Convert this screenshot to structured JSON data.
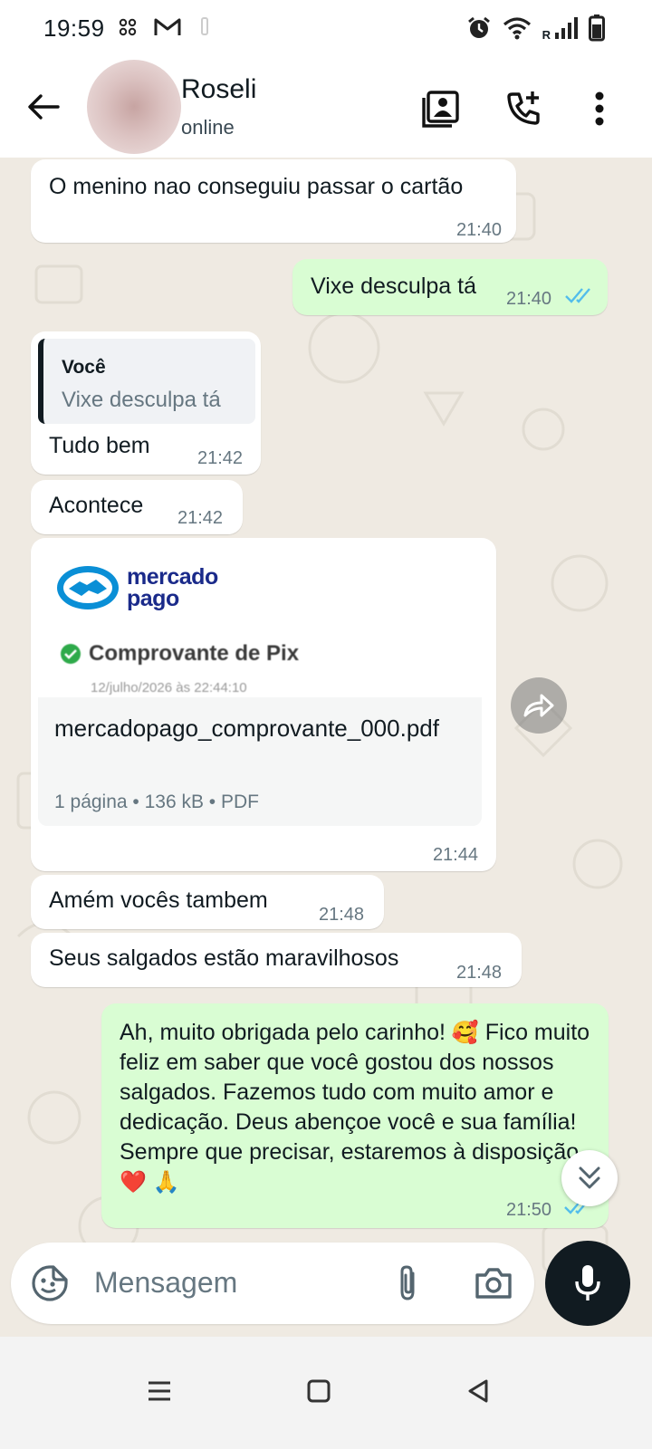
{
  "status_bar": {
    "time": "19:59",
    "network_label": "R",
    "icons": [
      "link-icon",
      "gmail-icon",
      "notification-icon",
      "alarm-icon",
      "wifi-icon",
      "signal-icon",
      "battery-icon"
    ]
  },
  "header": {
    "contact_name": "Roseli",
    "contact_status": "online",
    "icons": [
      "back-arrow-icon",
      "contact-card-icon",
      "add-call-icon",
      "more-vert-icon"
    ]
  },
  "messages": [
    {
      "direction": "in",
      "text": "O menino nao conseguiu passar o cartão",
      "time": "21:40"
    },
    {
      "direction": "out",
      "text": "Vixe desculpa tá",
      "time": "21:40",
      "status": "read"
    },
    {
      "direction": "in",
      "quote": {
        "author": "Você",
        "text": "Vixe desculpa tá"
      },
      "text": "Tudo bem",
      "time": "21:42"
    },
    {
      "direction": "in",
      "text": "Acontece",
      "time": "21:42"
    },
    {
      "direction": "in",
      "type": "document",
      "preview": {
        "brand_line1": "mercado",
        "brand_line2": "pago",
        "title": "Comprovante de Pix",
        "date": "12/julho/2026 às 22:44:10"
      },
      "file_name": "mercadopago_comprovante_000.pdf",
      "file_meta": "1 página • 136 kB • PDF",
      "time": "21:44"
    },
    {
      "direction": "in",
      "text": "Amém vocês tambem",
      "time": "21:48"
    },
    {
      "direction": "in",
      "text": "Seus salgados estão maravilhosos",
      "time": "21:48"
    },
    {
      "direction": "out",
      "text_part1": "Ah, muito obrigada pelo carinho! ",
      "emoji1": "🥰",
      "text_part2": " Fico muito feliz em saber que você gostou dos nossos salgados. Fazemos tudo com muito amor e dedicação. Deus abençoe você e sua família! Sempre que precisar, estaremos à disposição. ",
      "emoji2": "❤️",
      "emoji3": "🙏",
      "time": "21:50",
      "status": "read"
    }
  ],
  "composer": {
    "placeholder": "Mensagem",
    "icons": [
      "sticker-icon",
      "attach-icon",
      "camera-icon",
      "mic-icon"
    ]
  },
  "navigation": [
    "recents-icon",
    "home-icon",
    "back-icon"
  ],
  "colors": {
    "incoming_bubble": "#ffffff",
    "outgoing_bubble": "#d9fdd3",
    "chat_background": "#efeae2",
    "read_ticks": "#53bdeb",
    "mic_button": "#111b21",
    "brand_blue": "#1a2a8a",
    "pix_check": "#2eaa4a"
  }
}
